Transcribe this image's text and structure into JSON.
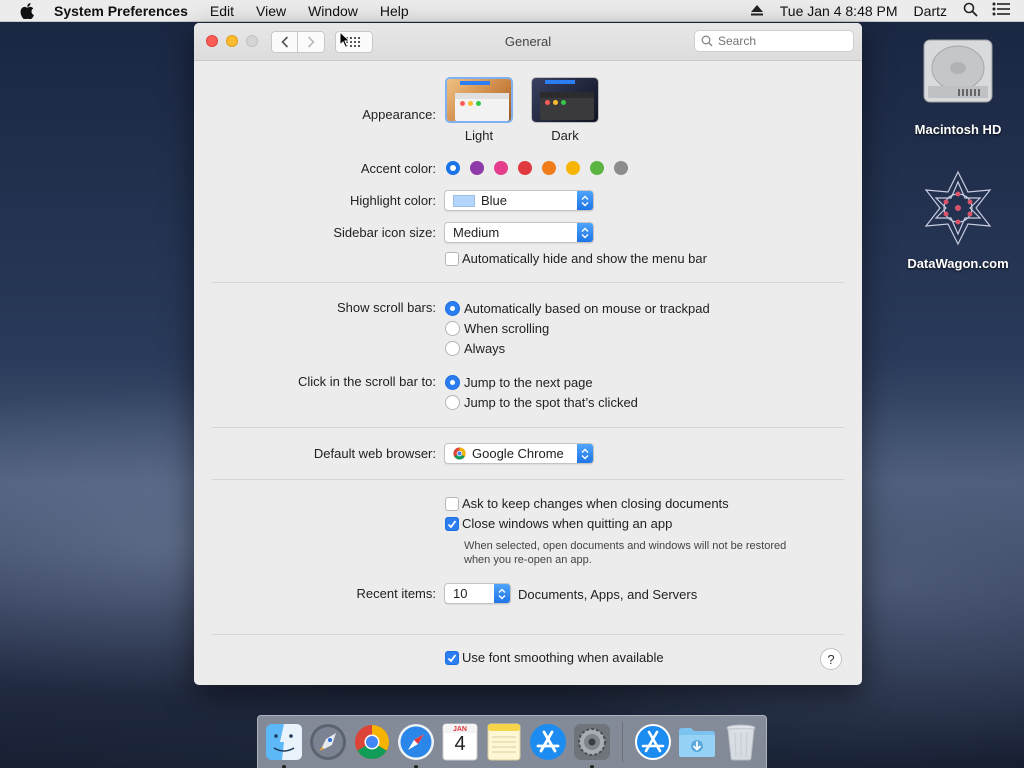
{
  "menubar": {
    "app_name": "System Preferences",
    "menus": [
      "Edit",
      "View",
      "Window",
      "Help"
    ],
    "datetime": "Tue Jan 4  8:48 PM",
    "user": "Dartz"
  },
  "window": {
    "title": "General",
    "search_placeholder": "Search"
  },
  "appearance": {
    "label": "Appearance:",
    "options": [
      {
        "name": "Light",
        "selected": true
      },
      {
        "name": "Dark",
        "selected": false
      }
    ]
  },
  "accent": {
    "label": "Accent color:",
    "colors": [
      "#1a73e8",
      "#8e3aa8",
      "#e63d8e",
      "#e0393e",
      "#f07d1a",
      "#f7b500",
      "#5db541",
      "#8c8c8c"
    ]
  },
  "highlight": {
    "label": "Highlight color:",
    "value": "Blue",
    "swatch_color": "#b4d5fc"
  },
  "sidebar_icon": {
    "label": "Sidebar icon size:",
    "value": "Medium"
  },
  "menubar_autohide": {
    "label": "Automatically hide and show the menu bar",
    "checked": false
  },
  "scroll_bars": {
    "label": "Show scroll bars:",
    "options": [
      {
        "label": "Automatically based on mouse or trackpad",
        "selected": true
      },
      {
        "label": "When scrolling",
        "selected": false
      },
      {
        "label": "Always",
        "selected": false
      }
    ]
  },
  "scroll_click": {
    "label": "Click in the scroll bar to:",
    "options": [
      {
        "label": "Jump to the next page",
        "selected": true
      },
      {
        "label": "Jump to the spot that’s clicked",
        "selected": false
      }
    ]
  },
  "browser": {
    "label": "Default web browser:",
    "value": "Google Chrome"
  },
  "documents": {
    "ask_keep": {
      "label": "Ask to keep changes when closing documents",
      "checked": false
    },
    "close_windows": {
      "label": "Close windows when quitting an app",
      "checked": true
    },
    "note_line1": "When selected, open documents and windows will not be restored",
    "note_line2": "when you re-open an app."
  },
  "recent": {
    "label": "Recent items:",
    "value": "10",
    "suffix": "Documents, Apps, and Servers"
  },
  "font_smoothing": {
    "label": "Use font smoothing when available",
    "checked": true
  },
  "help_label": "?",
  "desktop_icons": [
    {
      "name": "Macintosh HD"
    },
    {
      "name": "DataWagon.com"
    }
  ],
  "dock": {
    "items": [
      "Finder",
      "Launchpad",
      "Google Chrome",
      "Safari",
      "Calendar",
      "Notes",
      "App Store",
      "System Preferences",
      "Downloads (App Store)",
      "Downloads Folder",
      "Trash"
    ],
    "calendar_month": "JAN",
    "calendar_day": "4"
  }
}
